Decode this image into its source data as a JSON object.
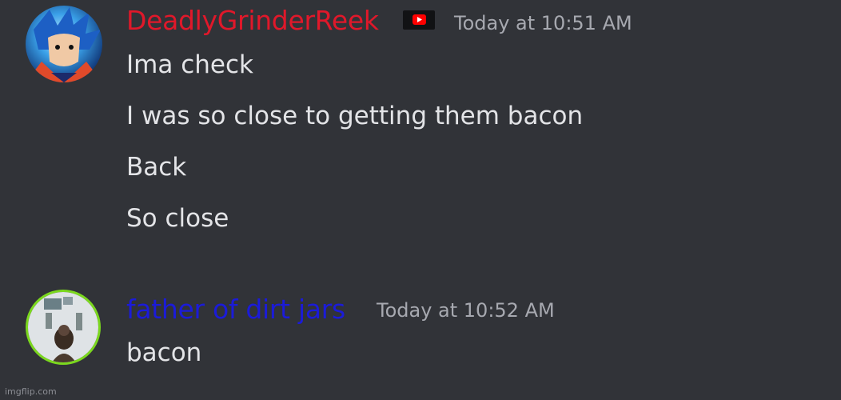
{
  "colors": {
    "background": "#313338",
    "username1": "#e0182a",
    "username2": "#1b1bd9",
    "message_text": "#e3e4e7",
    "timestamp": "#a7a9b0"
  },
  "messages": [
    {
      "author": "DeadlyGrinderReek",
      "badge_icon": "youtube-icon",
      "timestamp": "Today at 10:51 AM",
      "lines": [
        "Ima check",
        "I was so close to getting them bacon",
        "Back",
        "So close"
      ]
    },
    {
      "author": "father of dirt jars",
      "timestamp": "Today at 10:52 AM",
      "lines": [
        "bacon"
      ]
    }
  ],
  "watermark": "imgflip.com"
}
